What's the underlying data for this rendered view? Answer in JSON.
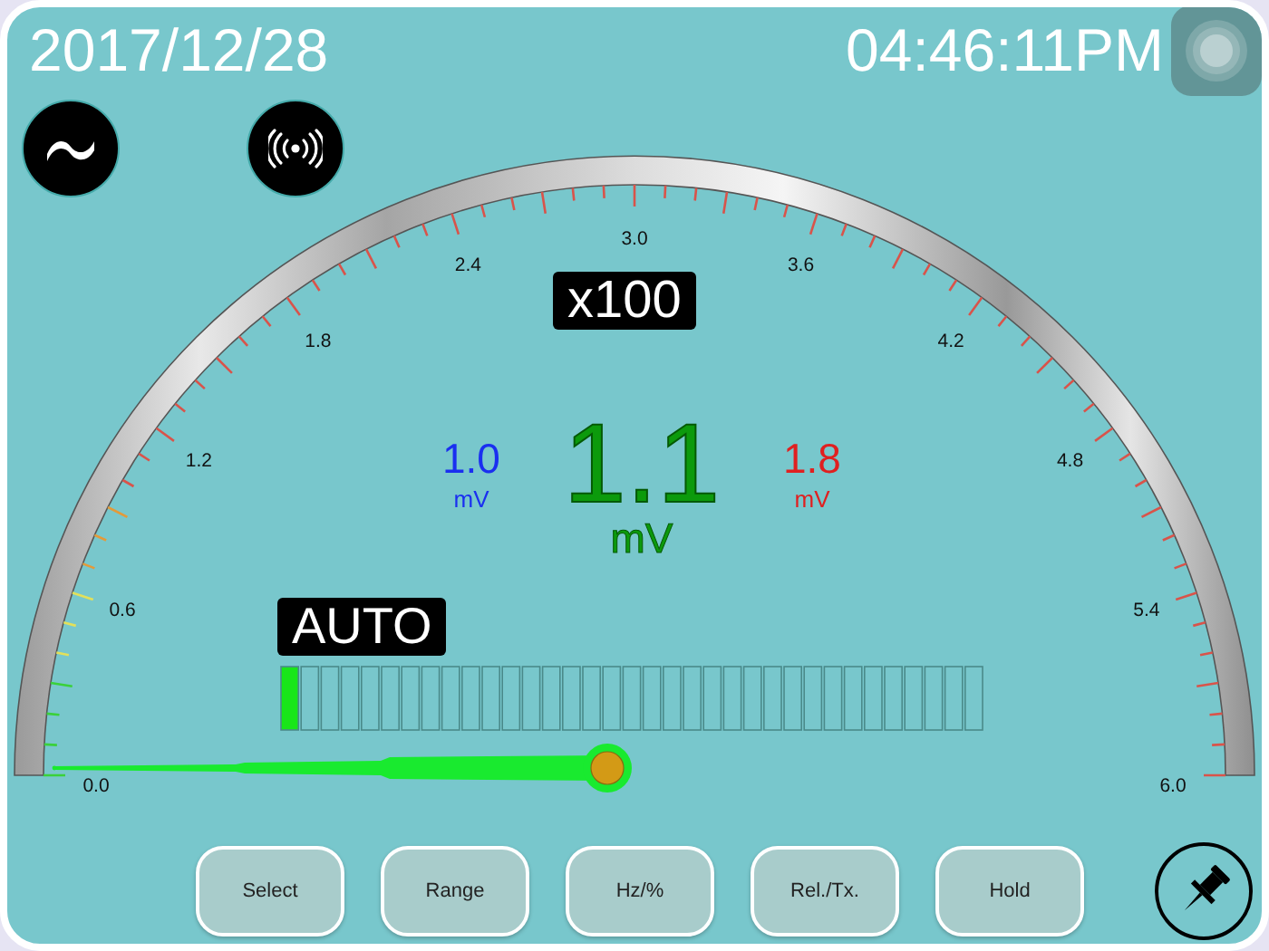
{
  "date": "2017/12/28",
  "time": "04:46:11PM",
  "gauge": {
    "scale_labels": [
      "0.0",
      "0.6",
      "1.2",
      "1.8",
      "2.4",
      "3.0",
      "3.6",
      "4.2",
      "4.8",
      "5.4",
      "6.0"
    ],
    "needle": {
      "level": 0
    },
    "multiplier": "x100",
    "range_mode": "AUTO",
    "bar_graph": {
      "level": 0.03
    }
  },
  "reading": {
    "value": "1.1",
    "unit": "mV",
    "min": {
      "value": "1.0",
      "unit": "mV"
    },
    "max": {
      "value": "1.8",
      "unit": "mV"
    }
  },
  "buttons": [
    "Select",
    "Range",
    "Hz/%",
    "Rel./Tx.",
    "Hold"
  ]
}
